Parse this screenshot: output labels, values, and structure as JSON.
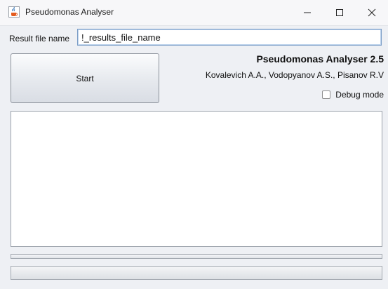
{
  "window": {
    "title": "Pseudomonas Analyser",
    "icon": "java-cup-icon"
  },
  "form": {
    "result_label": "Result file name",
    "result_value": "!_results_file_name"
  },
  "start_button": {
    "label": "Start"
  },
  "app_info": {
    "name": "Pseudomonas Analyser 2.5",
    "authors": "Kovalevich A.A., Vodopyanov A.S., Pisanov R.V"
  },
  "debug": {
    "label": "Debug mode",
    "checked": false
  },
  "log": {
    "text": ""
  },
  "progress": {
    "value": 0
  },
  "colors": {
    "titlebar_bg": "#f7f7f9",
    "content_bg": "#eef0f4",
    "input_border": "#7a9cc6"
  }
}
